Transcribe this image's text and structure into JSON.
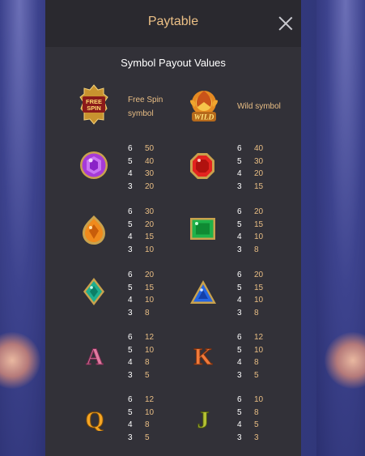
{
  "header": {
    "title": "Paytable"
  },
  "subtitle": "Symbol Payout Values",
  "specials": [
    {
      "name": "free-spin-symbol-icon",
      "logo_text": "FREE SPIN",
      "label_lines": [
        "Free Spin",
        "symbol"
      ]
    },
    {
      "name": "wild-symbol-icon",
      "logo_text": "WILD",
      "label_lines": [
        "Wild symbol"
      ]
    }
  ],
  "symbols": [
    {
      "icon": "purple-gem-icon",
      "pays": [
        [
          "6",
          "50"
        ],
        [
          "5",
          "40"
        ],
        [
          "4",
          "30"
        ],
        [
          "3",
          "20"
        ]
      ]
    },
    {
      "icon": "red-gem-icon",
      "pays": [
        [
          "6",
          "40"
        ],
        [
          "5",
          "30"
        ],
        [
          "4",
          "20"
        ],
        [
          "3",
          "15"
        ]
      ]
    },
    {
      "icon": "orange-gem-icon",
      "pays": [
        [
          "6",
          "30"
        ],
        [
          "5",
          "20"
        ],
        [
          "4",
          "15"
        ],
        [
          "3",
          "10"
        ]
      ]
    },
    {
      "icon": "green-gem-icon",
      "pays": [
        [
          "6",
          "20"
        ],
        [
          "5",
          "15"
        ],
        [
          "4",
          "10"
        ],
        [
          "3",
          "8"
        ]
      ]
    },
    {
      "icon": "teal-diamond-icon",
      "pays": [
        [
          "6",
          "20"
        ],
        [
          "5",
          "15"
        ],
        [
          "4",
          "10"
        ],
        [
          "3",
          "8"
        ]
      ]
    },
    {
      "icon": "blue-triangle-gem-icon",
      "pays": [
        [
          "6",
          "20"
        ],
        [
          "5",
          "15"
        ],
        [
          "4",
          "10"
        ],
        [
          "3",
          "8"
        ]
      ]
    },
    {
      "icon": "letter-a-icon",
      "letter": "A",
      "pays": [
        [
          "6",
          "12"
        ],
        [
          "5",
          "10"
        ],
        [
          "4",
          "8"
        ],
        [
          "3",
          "5"
        ]
      ]
    },
    {
      "icon": "letter-k-icon",
      "letter": "K",
      "pays": [
        [
          "6",
          "12"
        ],
        [
          "5",
          "10"
        ],
        [
          "4",
          "8"
        ],
        [
          "3",
          "5"
        ]
      ]
    },
    {
      "icon": "letter-q-icon",
      "letter": "Q",
      "pays": [
        [
          "6",
          "12"
        ],
        [
          "5",
          "10"
        ],
        [
          "4",
          "8"
        ],
        [
          "3",
          "5"
        ]
      ]
    },
    {
      "icon": "letter-j-icon",
      "letter": "J",
      "pays": [
        [
          "6",
          "10"
        ],
        [
          "5",
          "8"
        ],
        [
          "4",
          "5"
        ],
        [
          "3",
          "3"
        ]
      ]
    }
  ],
  "colors": {
    "panel": "#323138",
    "header": "#2a292f",
    "gold_text": "#e8bd84",
    "white_text": "#ffffff"
  }
}
